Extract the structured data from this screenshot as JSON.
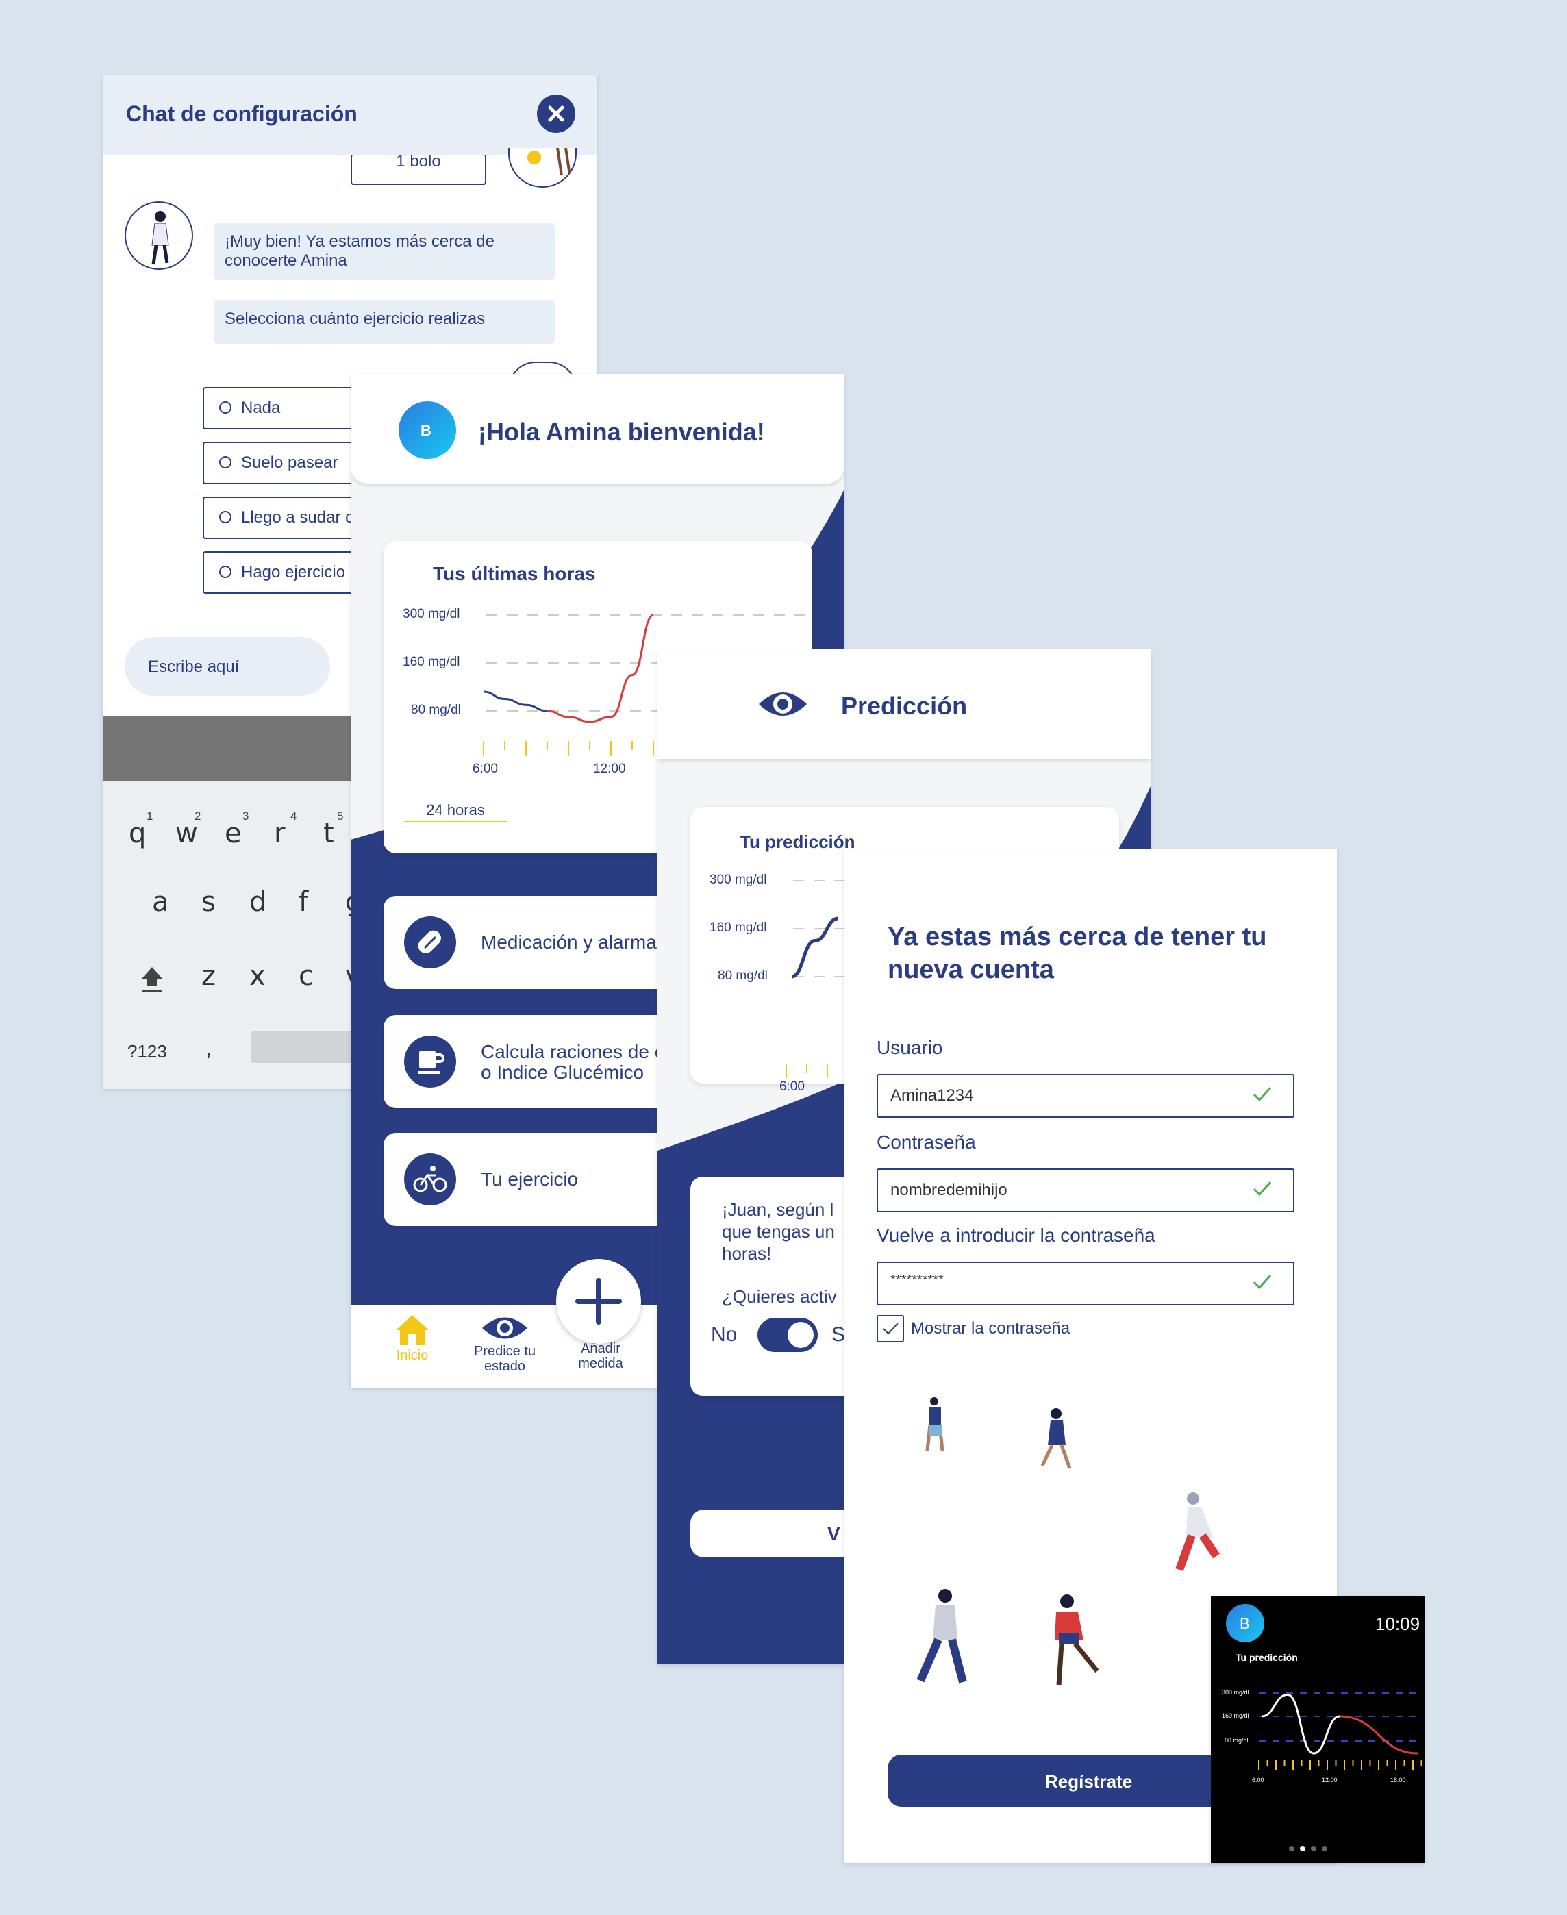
{
  "chat": {
    "title": "Chat de configuración",
    "prev_option": "1 bolo",
    "bubble1": "¡Muy bien! Ya estamos más cerca de conocerte Amina",
    "bubble2": "Selecciona cuánto ejercicio realizas",
    "options": [
      "Nada",
      "Suelo pasear",
      "Llego a sudar c",
      "Hago ejercicio"
    ],
    "input_placeholder": "Escribe aquí",
    "keyboard": {
      "row1": [
        "q",
        "w",
        "e",
        "r",
        "t"
      ],
      "row1_nums": [
        "1",
        "2",
        "3",
        "4",
        "5"
      ],
      "row2": [
        "a",
        "s",
        "d",
        "f",
        "g"
      ],
      "row3": [
        "z",
        "x",
        "c",
        "v"
      ],
      "symbols": "?123",
      "comma": ","
    }
  },
  "home": {
    "avatar_letter": "B",
    "greeting": "¡Hola Amina bienvenida!",
    "chart_title": "Tus últimas horas",
    "chart_range_tab": "24 horas",
    "menu": [
      {
        "label": "Medicación y alarma",
        "icon": "pill-icon"
      },
      {
        "label_line1": "Calcula raciones de c",
        "label_line2": "o Indice Glucémico",
        "icon": "cup-icon"
      },
      {
        "label": "Tu ejercicio",
        "icon": "bike-icon"
      }
    ],
    "nav": [
      {
        "label": "Inicio",
        "icon": "home-icon"
      },
      {
        "label_line1": "Predice tu",
        "label_line2": "estado",
        "icon": "eye-icon"
      },
      {
        "label_line1": "Añadir",
        "label_line2": "medida",
        "icon": "plus-icon"
      }
    ]
  },
  "prediction": {
    "title": "Predicción",
    "chart_title": "Tu predicción",
    "message_line1": "¡Juan, según l",
    "message_line2": "que tengas un",
    "message_line3": "horas!",
    "question": "¿Quieres activ",
    "toggle_no": "No",
    "toggle_yes": "S",
    "button_partial": "V"
  },
  "register": {
    "title_line1": "Ya estas más cerca de tener tu",
    "title_line2": "nueva cuenta",
    "user_label": "Usuario",
    "user_value": "Amina1234",
    "pass_label": "Contraseña",
    "pass_value": "nombredemihijo",
    "pass2_label": "Vuelve a introducir la contraseña",
    "pass2_value": "**********",
    "show_pass": "Mostrar la contraseña",
    "button": "Regístrate"
  },
  "watch": {
    "avatar_letter": "B",
    "time": "10:09",
    "title": "Tu predicción"
  },
  "chart_data": [
    {
      "type": "line",
      "title": "Tus últimas horas",
      "y_ticks": [
        "300 mg/dl",
        "160 mg/dl",
        "80 mg/dl"
      ],
      "x_ticks": [
        "6:00",
        "12:00"
      ],
      "series": [
        {
          "color": "#2b3d82",
          "x": [
            6,
            7,
            8,
            9
          ],
          "y": [
            112,
            100,
            90,
            80
          ]
        },
        {
          "color": "#d93a3a",
          "x": [
            9,
            10,
            11,
            12,
            13,
            14
          ],
          "y": [
            80,
            70,
            62,
            70,
            140,
            300
          ]
        }
      ]
    },
    {
      "type": "line",
      "title": "Tu predicción",
      "y_ticks": [
        "300 mg/dl",
        "160 mg/dl",
        "80 mg/dl"
      ],
      "x_ticks": [
        "6:00"
      ],
      "series": [
        {
          "color": "#2b3d82",
          "x": [
            6,
            7,
            8
          ],
          "y": [
            80,
            140,
            190
          ]
        }
      ]
    },
    {
      "type": "line",
      "title": "Tu predicción",
      "y_ticks": [
        "300 mg/dl",
        "160 mg/dl",
        "80 mg/dl"
      ],
      "x_ticks": [
        "6:00",
        "12:00",
        "18:00"
      ],
      "series": [
        {
          "color": "#ffffff",
          "x": [
            6,
            8,
            10,
            12
          ],
          "y": [
            160,
            290,
            40,
            160
          ]
        },
        {
          "color": "#d93a3a",
          "x": [
            12,
            18
          ],
          "y": [
            160,
            40
          ]
        }
      ]
    }
  ],
  "colors": {
    "primary": "#2b3d82",
    "accent": "#f5c518",
    "danger": "#d93a3a",
    "ok": "#4caf50"
  }
}
